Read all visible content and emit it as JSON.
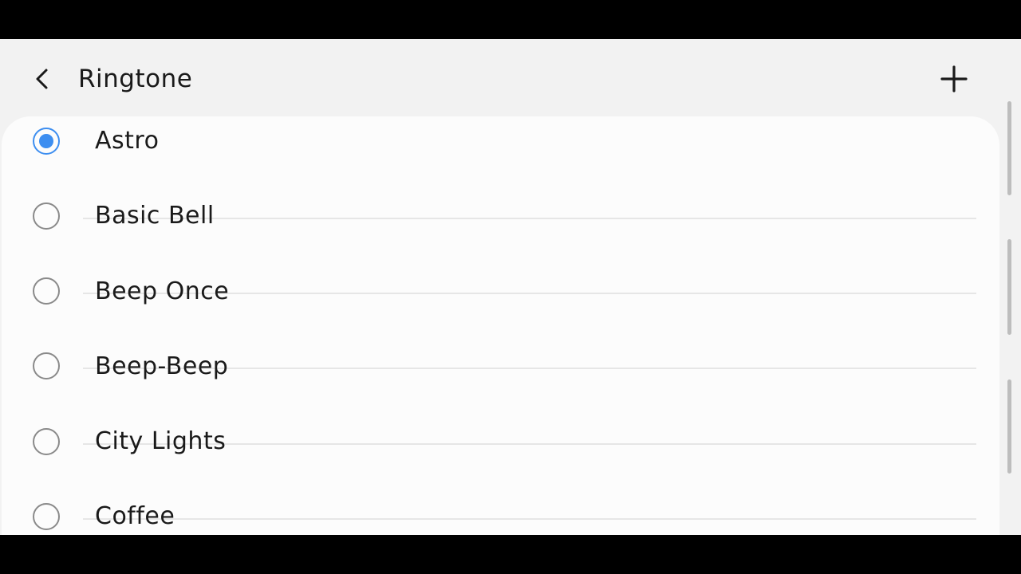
{
  "header": {
    "title": "Ringtone",
    "back_icon": "chevron-left-icon",
    "add_icon": "plus-icon"
  },
  "ringtones": [
    {
      "label": "Astro",
      "selected": true
    },
    {
      "label": "Basic Bell",
      "selected": false
    },
    {
      "label": "Beep Once",
      "selected": false
    },
    {
      "label": "Beep-Beep",
      "selected": false
    },
    {
      "label": "City Lights",
      "selected": false
    },
    {
      "label": "Coffee",
      "selected": false
    }
  ],
  "colors": {
    "accent": "#3d8ef0",
    "background": "#f2f2f2",
    "card": "#fcfcfc"
  }
}
